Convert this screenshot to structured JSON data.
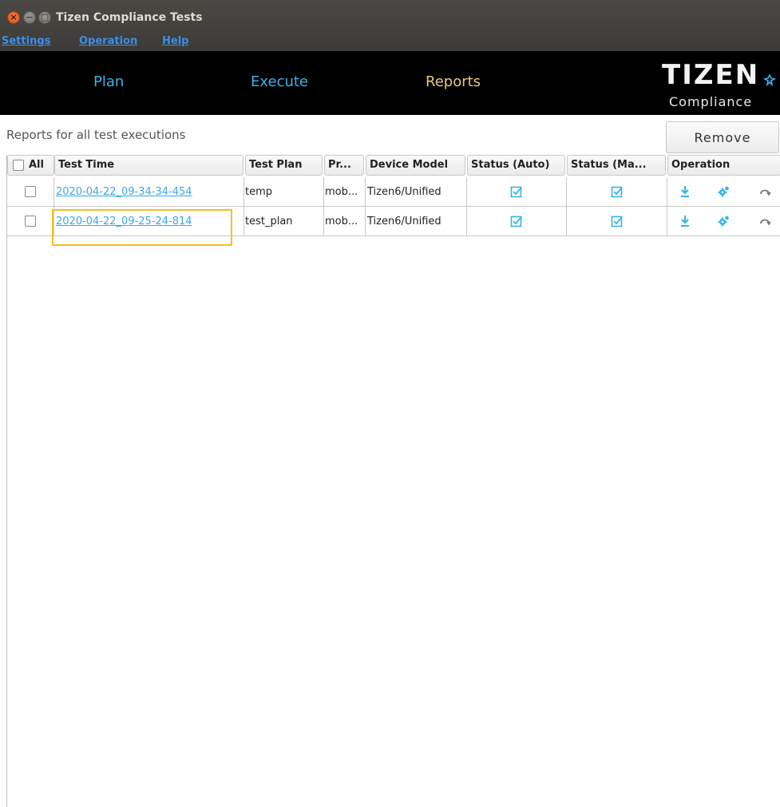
{
  "window": {
    "title": "Tizen Compliance Tests"
  },
  "menu": [
    "Settings",
    "Operation",
    "Help"
  ],
  "nav": {
    "plan": "Plan",
    "execute": "Execute",
    "reports": "Reports"
  },
  "logo": {
    "main": "TIZEN",
    "sub": "Compliance"
  },
  "reports": {
    "label": "Reports for all test executions",
    "remove_label": "Remove",
    "columns": {
      "all": "All",
      "test_time": "Test Time",
      "test_plan": "Test Plan",
      "profile": "Pr...",
      "device_model": "Device Model",
      "status_auto": "Status (Auto)",
      "status_manual": "Status (Ma...",
      "operation": "Operation"
    },
    "rows": [
      {
        "test_time": "2020-04-22_09-34-34-454",
        "test_plan": "temp",
        "profile": "mob...",
        "device_model": "Tizen6/Unified"
      },
      {
        "test_time": "2020-04-22_09-25-24-814",
        "test_plan": "test_plan",
        "profile": "mob...",
        "device_model": "Tizen6/Unified"
      }
    ]
  },
  "colors": {
    "nav_active": "#e8c97a",
    "nav_inactive": "#38b4e6",
    "link": "#3aa9e6",
    "highlight": "#f1c21b"
  },
  "icons": [
    "close-icon",
    "minimize-icon",
    "maximize-icon",
    "tizen-star-icon",
    "checkbox-checked-icon",
    "download-icon",
    "gear-icon",
    "refresh-icon"
  ]
}
